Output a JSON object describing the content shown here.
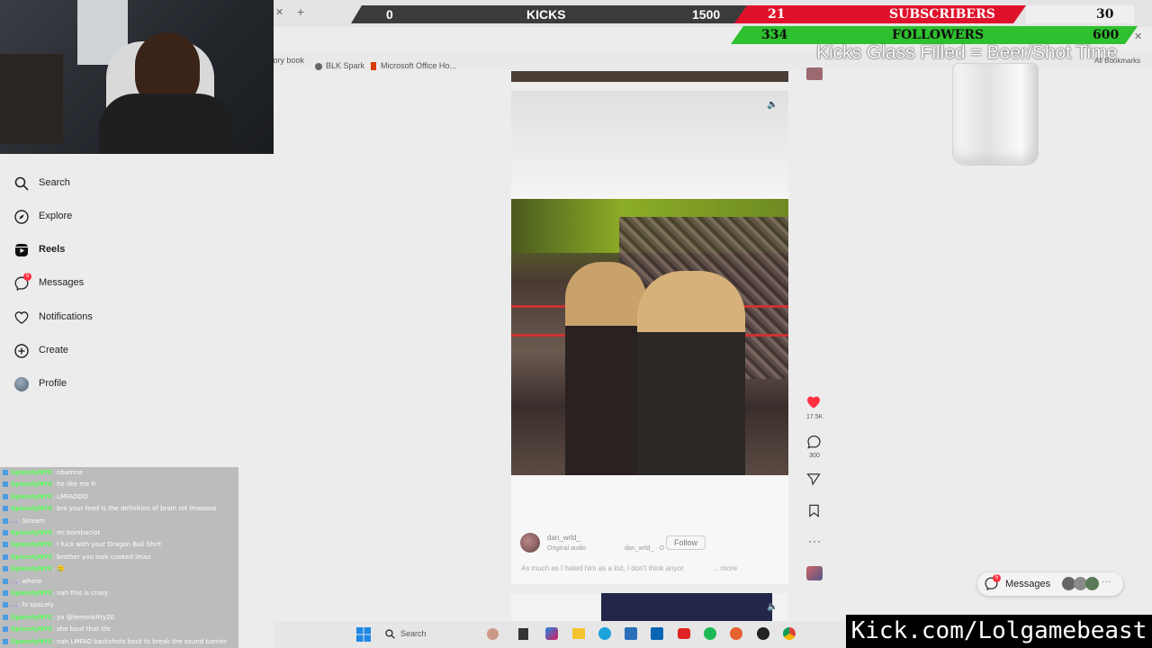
{
  "overlay": {
    "kicks": {
      "current": "0",
      "label": "KICKS",
      "goal": "1500"
    },
    "subscribers": {
      "current": "21",
      "label": "SUBSCRIBERS",
      "goal": "30"
    },
    "followers": {
      "current": "334",
      "label": "FOLLOWERS",
      "goal": "600"
    },
    "glass_text": "Kicks Glass Filled = Beer/Shot Time",
    "kick_url": "Kick.com/Lolgamebeast",
    "colors": {
      "kicks_bar": "#3b3b3b",
      "subs_bar": "#e0112b",
      "followers_bar": "#2ec02e"
    }
  },
  "browser": {
    "bookmarks": [
      "...ory book",
      "BLK Spark",
      "Microsoft Office Ho..."
    ],
    "all_bookmarks": "All Bookmarks"
  },
  "sidebar": {
    "items": [
      {
        "label": "Search",
        "icon": "search-icon"
      },
      {
        "label": "Explore",
        "icon": "compass-icon"
      },
      {
        "label": "Reels",
        "icon": "reels-icon",
        "active": true
      },
      {
        "label": "Messages",
        "icon": "messenger-icon",
        "badge": "5"
      },
      {
        "label": "Notifications",
        "icon": "heart-icon"
      },
      {
        "label": "Create",
        "icon": "plus-square-icon"
      },
      {
        "label": "Profile",
        "icon": "avatar-icon"
      }
    ]
  },
  "reel": {
    "username": "dan_wrld_",
    "audio": "Original audio",
    "audio_credit": "dan_wrld_ · O",
    "follow_label": "Follow",
    "caption": "As much as I hated him as a kid, I don't think anyor",
    "more": "... more",
    "likes": "17.5K",
    "comments": "300"
  },
  "messages_button": {
    "label": "Messages",
    "badge": "5"
  },
  "taskbar": {
    "search_placeholder": "Search"
  },
  "chat": [
    {
      "user": "SpacelyNYC",
      "text": ": obamna"
    },
    {
      "user": "SpacelyNYC",
      "text": ": he like me fr"
    },
    {
      "user": "SpacelyNYC",
      "text": ": LMFAOOO"
    },
    {
      "user": "SpacelyNYC",
      "text": ": bro your feed is the definition of brain rot lmaoooo"
    },
    {
      "user": "...",
      "text": ": Stream",
      "alt": true
    },
    {
      "user": "SpacelyNYC",
      "text": ": mi bombaclot"
    },
    {
      "user": "SpacelyNYC",
      "text": ": I fuck with your Dragon Ball Shirt"
    },
    {
      "user": "SpacelyNYC",
      "text": ": brother you look cooked lmao"
    },
    {
      "user": "SpacelyNYC",
      "text": ": 🥲"
    },
    {
      "user": "...",
      "text": ": whore",
      "alt": true
    },
    {
      "user": "SpacelyNYC",
      "text": ": nah this is crazy"
    },
    {
      "user": "...",
      "text": ": hi spacely",
      "alt": true
    },
    {
      "user": "SpacelyNYC",
      "text": ": yo @lemonkitty20"
    },
    {
      "user": "SpacelyNYC",
      "text": ": she bout that life"
    },
    {
      "user": "SpacelyNYC",
      "text": ": nah LMFAO backshots bout to break the sound barrier"
    }
  ]
}
